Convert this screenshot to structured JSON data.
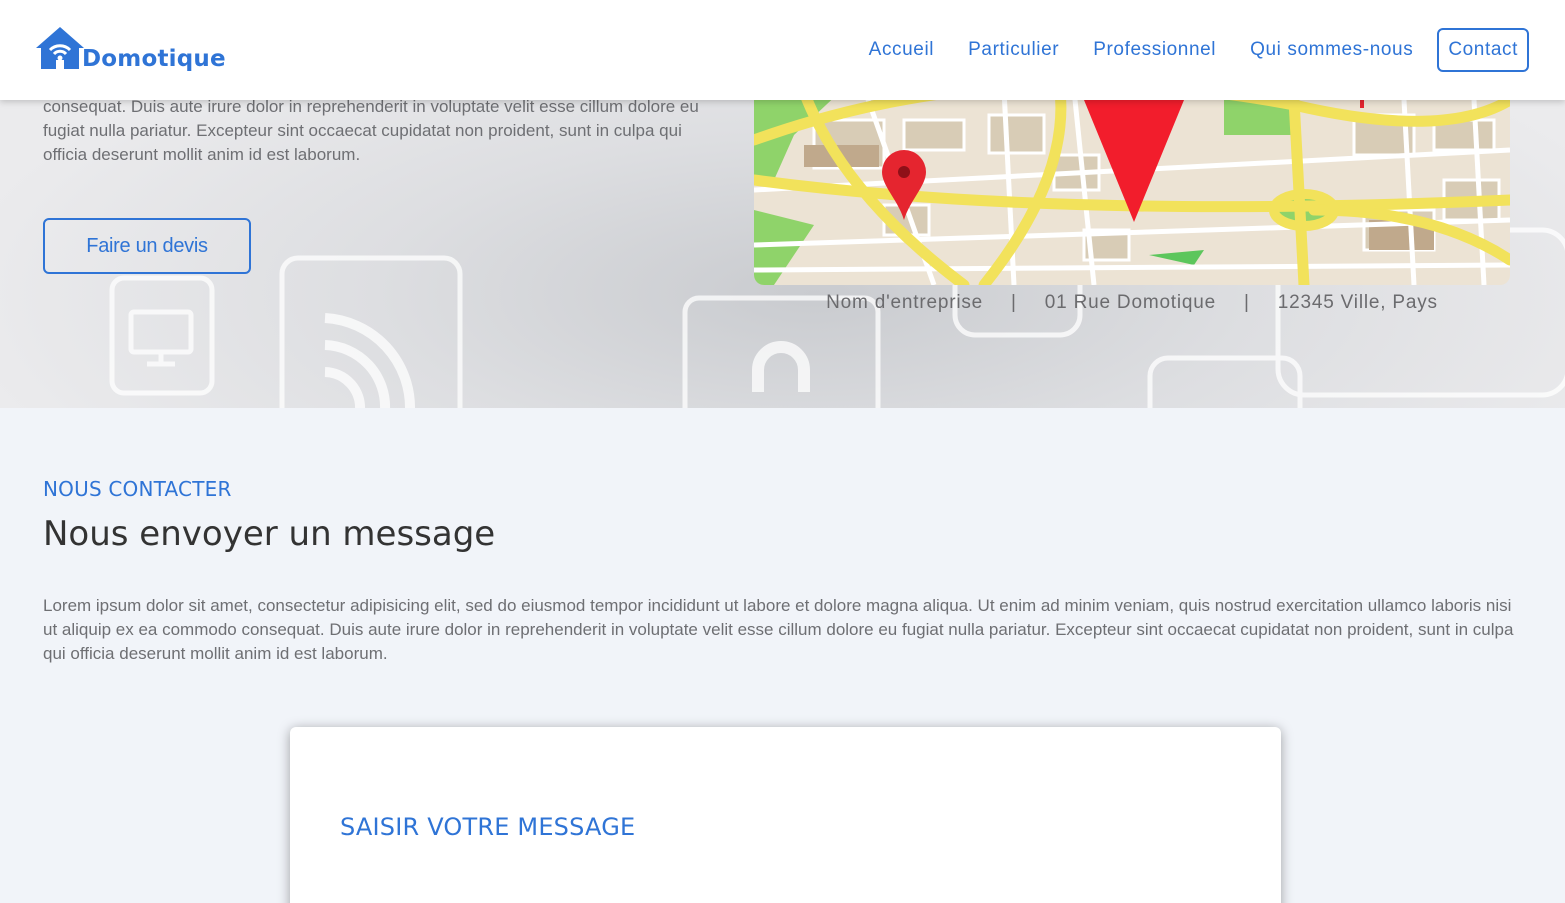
{
  "brand": {
    "name": "Domotique",
    "color": "#2f74d6"
  },
  "nav": {
    "items": [
      {
        "label": "Accueil"
      },
      {
        "label": "Particulier"
      },
      {
        "label": "Professionnel"
      },
      {
        "label": "Qui sommes-nous"
      }
    ],
    "contact_label": "Contact"
  },
  "hero": {
    "text": "consequat. Duis aute irure dolor in reprehenderit in voluptate velit esse cillum dolore eu fugiat nulla pariatur. Excepteur sint occaecat cupidatat non proident, sunt in culpa qui officia deserunt mollit anim id est laborum.",
    "button_label": "Faire un devis",
    "address": {
      "company": "Nom d'entreprise",
      "street": "01 Rue Domotique",
      "city": "12345 Ville, Pays",
      "separator": "|"
    }
  },
  "contact": {
    "eyebrow": "NOUS CONTACTER",
    "title": "Nous envoyer un message",
    "body": "Lorem ipsum dolor sit amet, consectetur adipisicing elit, sed do eiusmod tempor incididunt ut labore et dolore magna aliqua. Ut enim ad minim veniam, quis nostrud exercitation ullamco laboris nisi ut aliquip ex ea commodo consequat. Duis aute irure dolor in reprehenderit in voluptate velit esse cillum dolore eu fugiat nulla pariatur. Excepteur sint occaecat cupidatat non proident, sunt in culpa qui officia deserunt mollit anim id est laborum.",
    "form_title": "SAISIR VOTRE MESSAGE"
  },
  "icons": {
    "logo": "house-wifi-icon",
    "map_pins": "map-pin-icon",
    "hero_background": [
      "tv-icon",
      "wifi-icon",
      "lock-icon"
    ]
  }
}
